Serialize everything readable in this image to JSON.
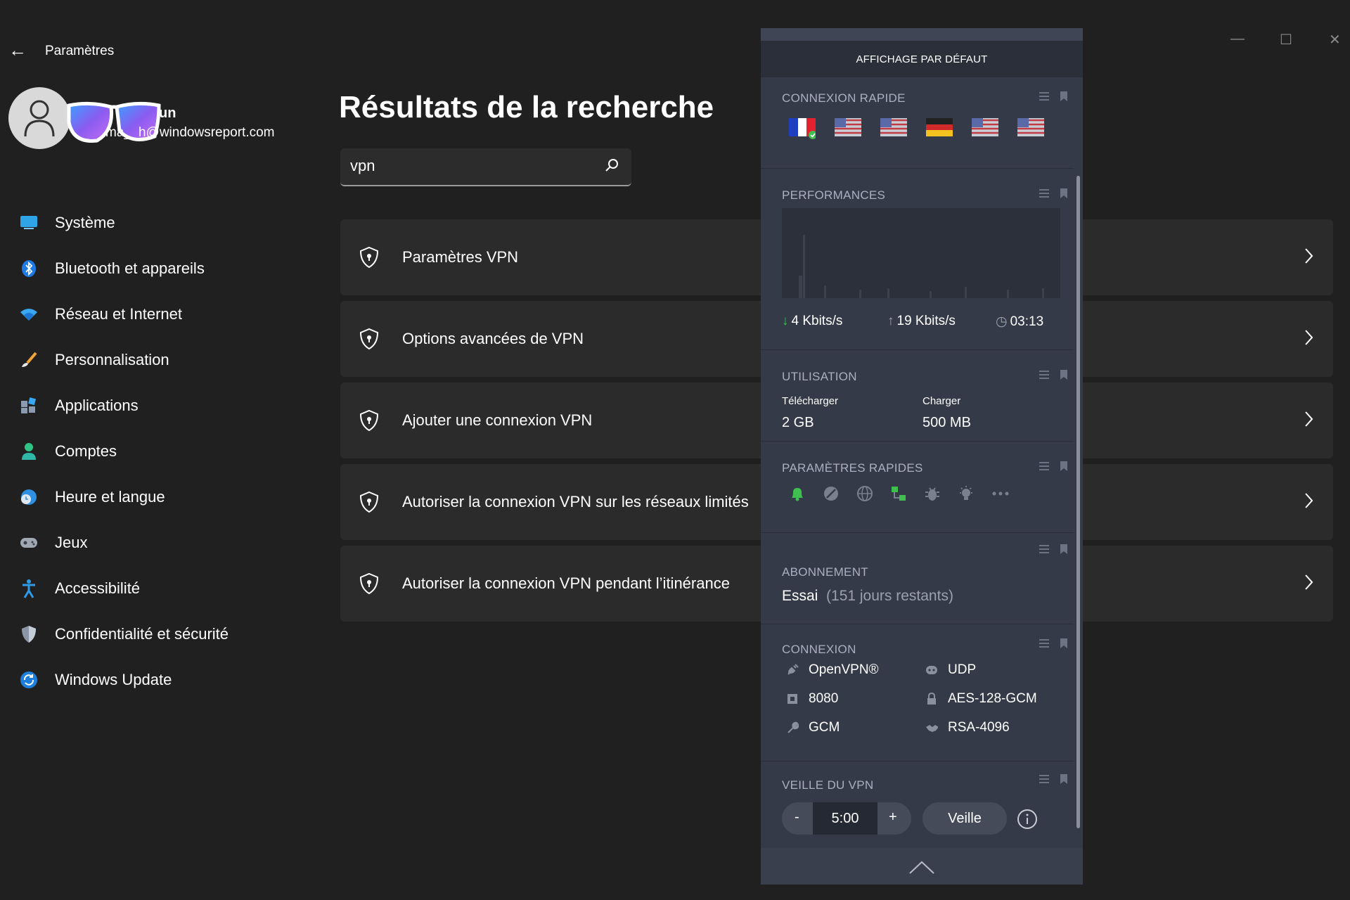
{
  "window": {
    "title": "Paramètres",
    "controls": {
      "minimize": "—",
      "maximize": "☐",
      "close": "✕"
    }
  },
  "profile": {
    "name": "un",
    "email": "h@windowsreport.com",
    "email_prefix": "ma_"
  },
  "sidebar": {
    "items": [
      {
        "label": "Système",
        "icon": "monitor-icon"
      },
      {
        "label": "Bluetooth et appareils",
        "icon": "bluetooth-icon"
      },
      {
        "label": "Réseau et Internet",
        "icon": "wifi-icon"
      },
      {
        "label": "Personnalisation",
        "icon": "brush-icon"
      },
      {
        "label": "Applications",
        "icon": "apps-icon"
      },
      {
        "label": "Comptes",
        "icon": "person-icon"
      },
      {
        "label": "Heure et langue",
        "icon": "clock-globe-icon"
      },
      {
        "label": "Jeux",
        "icon": "gamepad-icon"
      },
      {
        "label": "Accessibilité",
        "icon": "accessibility-icon"
      },
      {
        "label": "Confidentialité et sécurité",
        "icon": "shield-icon"
      },
      {
        "label": "Windows Update",
        "icon": "update-icon"
      }
    ]
  },
  "main": {
    "title": "Résultats de la recherche",
    "search": {
      "value": "vpn",
      "placeholder": ""
    },
    "results": [
      {
        "label": "Paramètres VPN"
      },
      {
        "label": "Options avancées de VPN"
      },
      {
        "label": "Ajouter une connexion VPN"
      },
      {
        "label": "Autoriser la connexion VPN sur les réseaux limités"
      },
      {
        "label": "Autoriser la connexion VPN pendant l’itinérance"
      }
    ]
  },
  "vpn": {
    "header": "AFFICHAGE PAR DÉFAUT",
    "quick_connect": {
      "title": "CONNEXION RAPIDE",
      "flags": [
        "France",
        "United States",
        "United States",
        "Germany",
        "United States",
        "United States"
      ],
      "connected_index": 0
    },
    "performance": {
      "title": "PERFORMANCES",
      "download": "4 Kbits/s",
      "upload": "19 Kbits/s",
      "time": "03:13"
    },
    "usage": {
      "title": "UTILISATION",
      "download_label": "Télécharger",
      "download_value": "2 GB",
      "upload_label": "Charger",
      "upload_value": "500 MB"
    },
    "quick_settings": {
      "title": "PARAMÈTRES RAPIDES",
      "icons": [
        "bell-icon",
        "block-icon",
        "globe-icon",
        "network-icon",
        "bug-icon",
        "bulb-icon",
        "more-icon"
      ]
    },
    "subscription": {
      "title": "ABONNEMENT",
      "plan": "Essai",
      "remaining": "(151 jours restants)"
    },
    "connection": {
      "title": "CONNEXION",
      "items": [
        {
          "label": "OpenVPN®",
          "icon": "plug-icon"
        },
        {
          "label": "UDP",
          "icon": "protocol-icon"
        },
        {
          "label": "8080",
          "icon": "port-icon"
        },
        {
          "label": "AES-128-GCM",
          "icon": "lock-icon"
        },
        {
          "label": "GCM",
          "icon": "wrench-icon"
        },
        {
          "label": "RSA-4096",
          "icon": "handshake-icon"
        }
      ]
    },
    "sleep": {
      "title": "VEILLE DU VPN",
      "minus": "-",
      "time": "5:00",
      "plus": "+",
      "button": "Veille"
    }
  },
  "colors": {
    "background": "#202020",
    "card": "#2b2b2b",
    "panel": "#353a48",
    "accent_green": "#3fbf4f"
  }
}
